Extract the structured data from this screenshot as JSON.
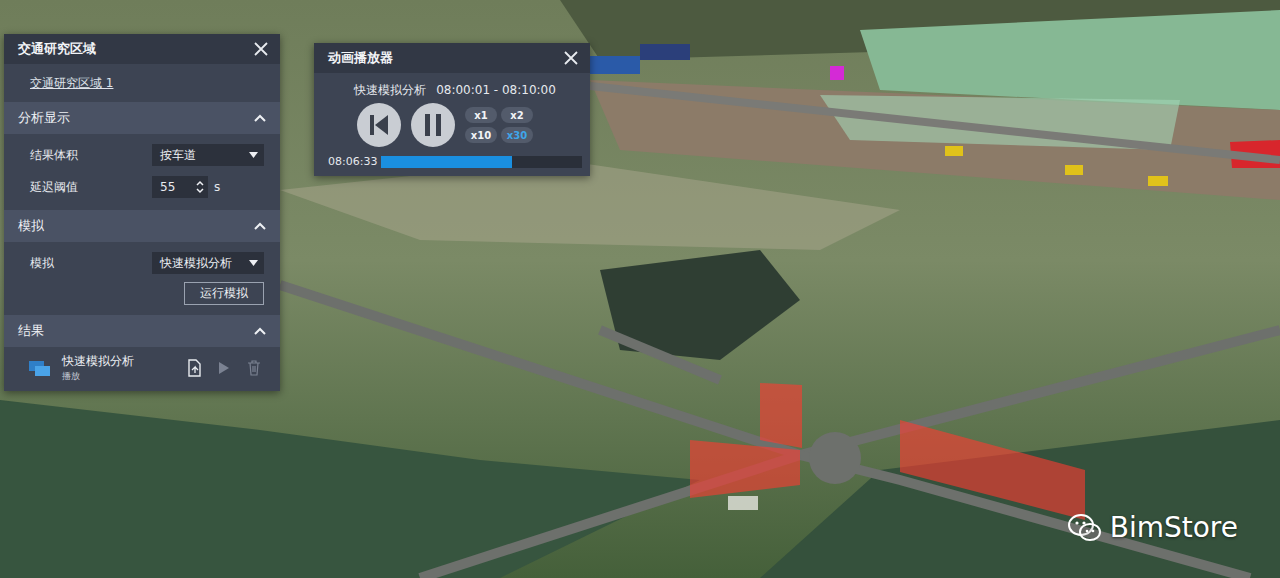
{
  "scene": {
    "watermark": "BimStore"
  },
  "study_panel": {
    "title": "交通研究区域",
    "link": "交通研究区域 1",
    "sections": [
      {
        "title": "分析显示",
        "expanded": true,
        "kind": "fields",
        "rows": [
          {
            "label": "结果体积",
            "kind": "select",
            "value": "按车道"
          },
          {
            "label": "延迟阈值",
            "kind": "spinner",
            "value": "55",
            "unit": "s"
          }
        ]
      },
      {
        "title": "模拟",
        "expanded": true,
        "kind": "fields",
        "rows": [
          {
            "label": "模拟",
            "kind": "select",
            "value": "快速模拟分析"
          }
        ],
        "button": "运行模拟"
      },
      {
        "title": "结果",
        "expanded": true,
        "kind": "results",
        "results": [
          {
            "name": "快速模拟分析",
            "status": "播放",
            "play_disabled": true,
            "delete_disabled": true
          }
        ]
      }
    ]
  },
  "player": {
    "title": "动画播放器",
    "clip": "快速模拟分析",
    "range": "08:00:01 - 08:10:00",
    "playing": true,
    "speeds": [
      {
        "label": "x1",
        "selected": false
      },
      {
        "label": "x2",
        "selected": false
      },
      {
        "label": "x10",
        "selected": false
      },
      {
        "label": "x30",
        "selected": true
      }
    ],
    "time": "08:06:33",
    "level": 0.65
  }
}
